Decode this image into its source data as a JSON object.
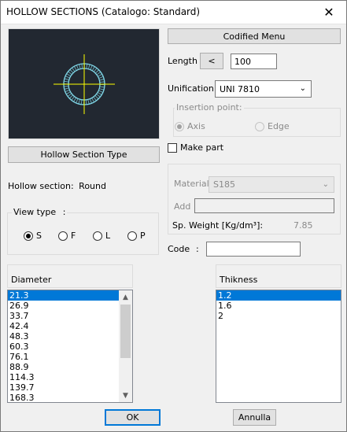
{
  "window": {
    "title": "HOLLOW SECTIONS (Catalogo: Standard)",
    "close_glyph": "✕"
  },
  "preview": {
    "icon": "round-hollow-section-icon",
    "bg_color": "#222831",
    "shape_color": "#7fd6e6",
    "axis_color": "#ffff00"
  },
  "codified_menu_label": "Codified Menu",
  "length": {
    "label": "Length",
    "less_button": "<",
    "value": "100"
  },
  "unification": {
    "label": "Unification",
    "value": "UNI 7810"
  },
  "insertion_point": {
    "caption": "Insertion point:",
    "options": [
      {
        "label": "Axis",
        "checked": true
      },
      {
        "label": "Edge",
        "checked": false
      }
    ]
  },
  "make_part": {
    "label": "Make part",
    "checked": false
  },
  "material": {
    "label": "Material",
    "value": "S185",
    "add_label": "Add",
    "add_value": "",
    "weight_label": "Sp. Weight [Kg/dm³]:",
    "weight_value": "7.85"
  },
  "code": {
    "label": "Code",
    "colon": ":",
    "value": ""
  },
  "section_type_button": "Hollow Section Type",
  "hollow_section": {
    "label": "Hollow section:",
    "value": "Round"
  },
  "view_type": {
    "caption": "View type",
    "colon": ":",
    "options": [
      {
        "label": "S",
        "checked": true
      },
      {
        "label": "F",
        "checked": false
      },
      {
        "label": "L",
        "checked": false
      },
      {
        "label": "P",
        "checked": false
      }
    ]
  },
  "diameter": {
    "header": "Diameter",
    "items": [
      "21.3",
      "26.9",
      "33.7",
      "42.4",
      "48.3",
      "60.3",
      "76.1",
      "88.9",
      "114.3",
      "139.7",
      "168.3"
    ],
    "selected_index": 0
  },
  "thickness": {
    "header": "Thikness",
    "items": [
      "1.2",
      "1.6",
      "2"
    ],
    "selected_index": 0
  },
  "ok_label": "OK",
  "cancel_label": "Annulla"
}
